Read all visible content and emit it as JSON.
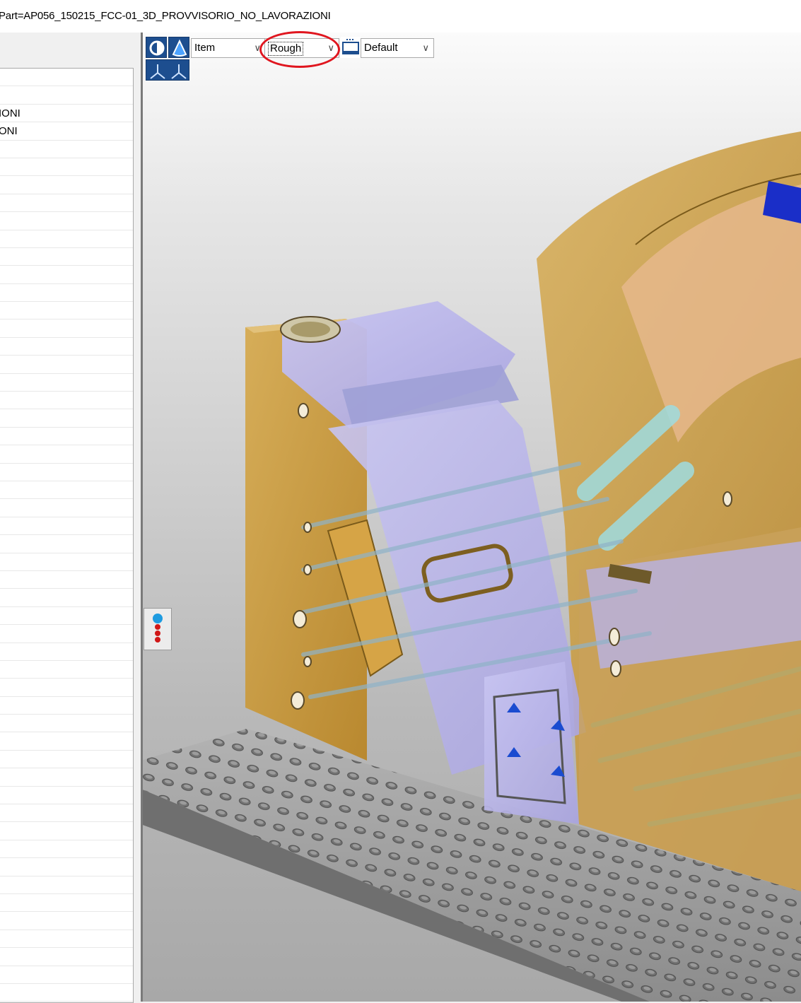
{
  "window": {
    "title": "Part=AP056_150215_FCC-01_3D_PROVVISORIO_NO_LAVORAZIONI"
  },
  "tree": {
    "rows": [
      "",
      "",
      "IONI",
      "ONI",
      "",
      "",
      "",
      "",
      "",
      "",
      "",
      "",
      "",
      "",
      "",
      "",
      "",
      "",
      "",
      "",
      "",
      "",
      "",
      "",
      "",
      "",
      "",
      "",
      "",
      "",
      "",
      "",
      "",
      "",
      "",
      "",
      "",
      "",
      "",
      "",
      "",
      "",
      "",
      "",
      "",
      "",
      "",
      "",
      "",
      "",
      "",
      "",
      ""
    ]
  },
  "toolbar": {
    "view_mode_icon": "circle-half-icon",
    "render_icon": "triangle-cone-icon",
    "axes_icon": "axes-icon",
    "scope_value": "Item",
    "quality_value": "Rough",
    "display_icon": "display-settings-icon",
    "style_value": "Default"
  },
  "colors": {
    "toolbar_blue": "#1d4e8f",
    "highlight_red": "#e0161f",
    "part_orange": "#c99a3a",
    "part_lavender": "#b7b3e8",
    "pipe_cyan": "#9fdce0",
    "base_plate_gray": "#8a8a8a"
  },
  "viewport": {
    "content": "3d-cad-model"
  }
}
